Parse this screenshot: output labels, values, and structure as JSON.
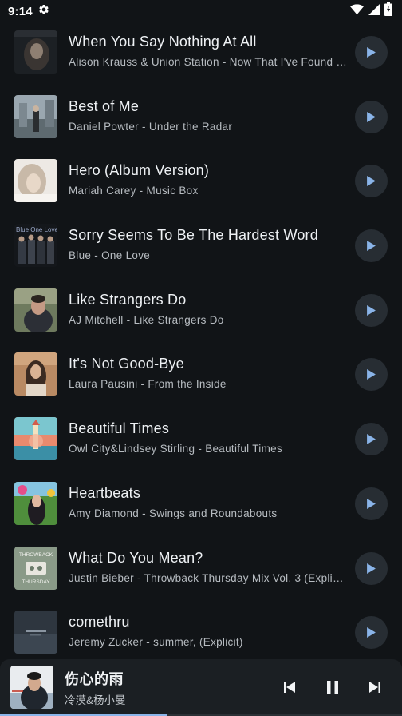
{
  "status_bar": {
    "time": "9:14"
  },
  "songs": [
    {
      "title": "When You Say Nothing At All",
      "subtitle": "Alison Krauss & Union Station - Now That I've Found …"
    },
    {
      "title": "Best of Me",
      "subtitle": "Daniel Powter - Under the Radar"
    },
    {
      "title": "Hero (Album Version)",
      "subtitle": "Mariah Carey - Music Box"
    },
    {
      "title": "Sorry Seems To Be The Hardest Word",
      "subtitle": "Blue - One Love"
    },
    {
      "title": "Like Strangers Do",
      "subtitle": "AJ Mitchell - Like Strangers Do"
    },
    {
      "title": "It's Not Good-Bye",
      "subtitle": "Laura Pausini - From the Inside"
    },
    {
      "title": "Beautiful Times",
      "subtitle": "Owl City&Lindsey Stirling - Beautiful Times"
    },
    {
      "title": "Heartbeats",
      "subtitle": "Amy Diamond - Swings and Roundabouts"
    },
    {
      "title": "What Do You Mean?",
      "subtitle": "Justin Bieber - Throwback Thursday Mix Vol. 3 (Explic…"
    },
    {
      "title": "comethru",
      "subtitle": "Jeremy Zucker - summer, (Explicit)"
    }
  ],
  "album_art_text": {
    "blue_one_love": "Blue One Love",
    "throwback": "THROWBACK",
    "thursday": "THURSDAY"
  },
  "now_playing": {
    "title": "伤心的雨",
    "artist": "冷漠&杨小曼",
    "progress": 0.415
  },
  "icons": {
    "settings": "gear-icon",
    "wifi": "wifi-icon",
    "signal": "signal-icon",
    "battery": "battery-icon",
    "play": "play-icon",
    "previous": "skip-previous-icon",
    "pause": "pause-icon",
    "next": "skip-next-icon"
  },
  "colors": {
    "background": "#111417",
    "accent": "#8ab4e8",
    "button_bg": "#272d33"
  }
}
